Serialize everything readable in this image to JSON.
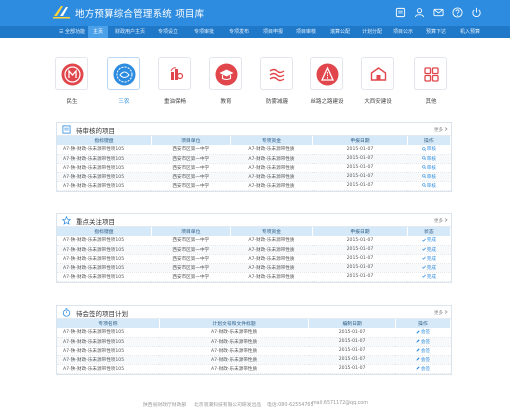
{
  "header": {
    "title": "地方预算综合管理系统   项目库",
    "icons": [
      "notice-icon",
      "user-icon",
      "mail-icon",
      "help-icon",
      "power-icon"
    ]
  },
  "nav": {
    "items": [
      {
        "label": "全部功能",
        "active": false
      },
      {
        "label": "主页",
        "active": true
      },
      {
        "label": "财政用户主页",
        "active": false
      },
      {
        "label": "专项设立",
        "active": false
      },
      {
        "label": "专项审批",
        "active": false
      },
      {
        "label": "专项发布",
        "active": false
      },
      {
        "label": "项目申报",
        "active": false
      },
      {
        "label": "项目审核",
        "active": false
      },
      {
        "label": "滚算公配",
        "active": false
      },
      {
        "label": "计划分配",
        "active": false
      },
      {
        "label": "项目公示",
        "active": false
      },
      {
        "label": "预算下达",
        "active": false
      },
      {
        "label": "机入预算",
        "active": false
      }
    ]
  },
  "categories": [
    {
      "label": "民生",
      "icon": "people-icon",
      "active": false
    },
    {
      "label": "三农",
      "icon": "agriculture-icon",
      "active": true
    },
    {
      "label": "重油保畅",
      "icon": "refinery-icon",
      "active": false
    },
    {
      "label": "教育",
      "icon": "education-icon",
      "active": false
    },
    {
      "label": "防雾减霾",
      "icon": "smog-icon",
      "active": false
    },
    {
      "label": "丝路之路建设",
      "icon": "silkroad-icon",
      "active": false
    },
    {
      "label": "大西安建设",
      "icon": "city-icon",
      "active": false
    },
    {
      "label": "其他",
      "icon": "other-icon",
      "active": false
    }
  ],
  "pending_review": {
    "title": "待审核的项目",
    "more": "更多",
    "columns": [
      "指标键盘",
      "项目单位",
      "专项资金",
      "申报日期",
      "操作"
    ],
    "rows": [
      [
        "A7-陕-财政-乐未源带性项105",
        "西安市区第一中学",
        "A7-财政-乐未源带性质",
        "2015-01-07",
        "审核"
      ],
      [
        "A7-陕-财政-乐未源带性项105",
        "西安市区第一中学",
        "A7-财政-乐未源带性质",
        "2015-01-07",
        "审核"
      ],
      [
        "A7-陕-财政-乐未源带性项105",
        "西安市区第一中学",
        "A7-财政-乐未源带性质",
        "2015-01-07",
        "审核"
      ],
      [
        "A7-陕-财政-乐未源带性项105",
        "西安市区第一中学",
        "A7-财政-乐未源带性质",
        "2015-01-07",
        "审核"
      ],
      [
        "A7-陕-财政-乐未源带性项105",
        "西安市区第一中学",
        "A7-财政-乐未源带性质",
        "2015-01-07",
        "审核"
      ]
    ]
  },
  "focus_projects": {
    "title": "重点关注项目",
    "more": "更多",
    "columns": [
      "指标键盘",
      "项目单位",
      "专项资金",
      "申报日期",
      "状态"
    ],
    "rows": [
      [
        "A7-陕-财政-乐未源带性项105",
        "西安市区第一中学",
        "A7-财政-乐未源带性质",
        "2015-01-07",
        "完成"
      ],
      [
        "A7-陕-财政-乐未源带性项105",
        "西安市区第一中学",
        "A7-财政-乐未源带性质",
        "2015-01-07",
        "完成"
      ],
      [
        "A7-陕-财政-乐未源带性项105",
        "西安市区第一中学",
        "A7-财政-乐未源带性质",
        "2015-01-07",
        "完成"
      ],
      [
        "A7-陕-财政-乐未源带性项105",
        "西安市区第一中学",
        "A7-财政-乐未源带性质",
        "2015-01-07",
        "完成"
      ],
      [
        "A7-陕-财政-乐未源带性项105",
        "西安市区第一中学",
        "A7-财政-乐未源带性质",
        "2015-01-07",
        "完成"
      ]
    ]
  },
  "pending_sign": {
    "title": "待会签的项目计划",
    "more": "更多",
    "columns": [
      "专项名称",
      "计划文号和文件标题",
      "编制日期",
      "操作"
    ],
    "rows": [
      [
        "A7-陕-财政-乐未源带性项105",
        "A7-财政-乐未源带性质",
        "2015-01-07",
        "会签"
      ],
      [
        "A7-陕-财政-乐未源带性项105",
        "A7-财政-乐未源带性质",
        "2015-01-07",
        "会签"
      ],
      [
        "A7-陕-财政-乐未源带性项105",
        "A7-财政-乐未源带性质",
        "2015-01-07",
        "会签"
      ],
      [
        "A7-陕-财政-乐未源带性项105",
        "A7-财政-乐未源带性质",
        "2015-01-07",
        "会签"
      ],
      [
        "A7-陕-财政-乐未源带性项105",
        "A7-财政-乐未源带性质",
        "2015-01-07",
        "会签"
      ]
    ]
  },
  "footer": {
    "left": "陕西省财政厅财政部",
    "mid": "北京浪潮科技有限公司研发出品",
    "phone": "电话:080-62554765",
    "email": "mail:6571172@qq.com"
  },
  "colors": {
    "primary": "#2d8cdf",
    "nav": "#1f78c8",
    "accent_red": "#e0464b",
    "th_bg": "#d6e9f8"
  }
}
